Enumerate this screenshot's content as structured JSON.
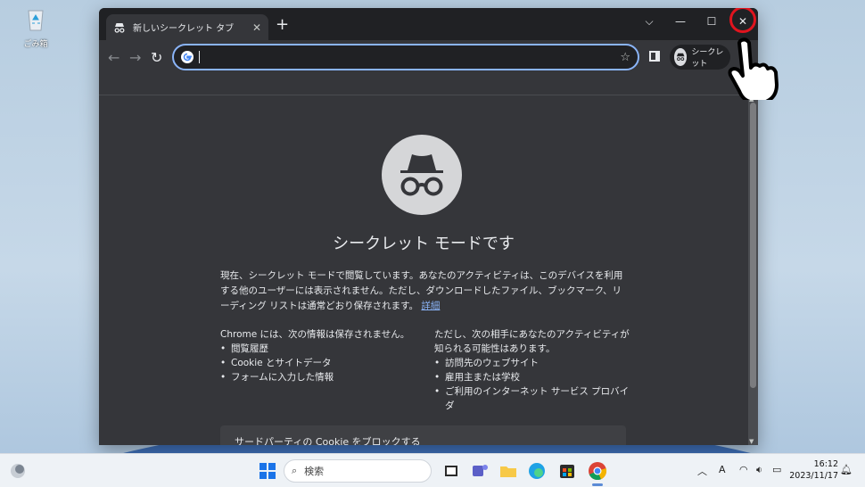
{
  "desktop": {
    "recycle_bin_label": "ごみ箱"
  },
  "browser": {
    "tab_title": "新しいシークレット タブ",
    "new_tab_symbol": "+",
    "window_controls": {
      "menu": "⌵",
      "minimize": "—",
      "maximize": "☐",
      "close": "✕"
    },
    "omnibox": {
      "value": "",
      "placeholder": ""
    },
    "profile_chip_label": "シークレット",
    "accent_color": "#8ab4f8"
  },
  "page": {
    "headline": "シークレット モードです",
    "description": "現在、シークレット モードで閲覧しています。あなたのアクティビティは、このデバイスを利用する他のユーザーには表示されません。ただし、ダウンロードしたファイル、ブックマーク、リーディング リストは通常どおり保存されます。",
    "learn_more": "詳細",
    "left_column": {
      "heading": "Chrome には、次の情報は保存されません。",
      "items": [
        "閲覧履歴",
        "Cookie とサイトデータ",
        "フォームに入力した情報"
      ]
    },
    "right_column": {
      "heading": "ただし、次の相手にあなたのアクティビティが知られる可能性はあります。",
      "items": [
        "訪問先のウェブサイト",
        "雇用主または学校",
        "ご利用のインターネット サービス プロバイダ"
      ]
    },
    "cookie_box_title": "サードパーティの Cookie をブロックする"
  },
  "taskbar": {
    "search_label": "検索",
    "clock_time": "16:12",
    "clock_date": "2023/11/17",
    "apps": [
      "widgets-icon",
      "start-icon",
      "task-view-icon",
      "teams-icon",
      "file-explorer-icon",
      "edge-icon",
      "store-icon",
      "chrome-icon"
    ]
  }
}
